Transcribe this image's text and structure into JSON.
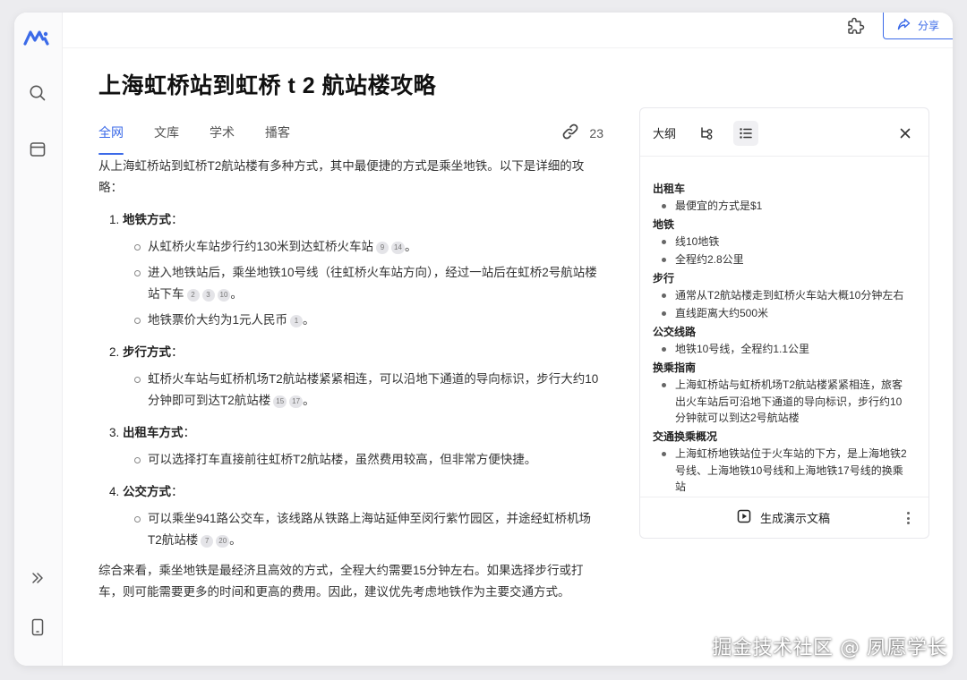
{
  "header": {
    "share_label": "分享"
  },
  "main": {
    "title": "上海虹桥站到虹桥 t 2 航站楼攻略",
    "tabs": [
      {
        "label": "全网"
      },
      {
        "label": "文库"
      },
      {
        "label": "学术"
      },
      {
        "label": "播客"
      }
    ],
    "reference_count": "23",
    "intro": "从上海虹桥站到虹桥T2航站楼有多种方式，其中最便捷的方式是乘坐地铁。以下是详细的攻略：",
    "sections": [
      {
        "number": "1.",
        "title": "地铁方式",
        "colon": "：",
        "bullets": [
          {
            "text": "从虹桥火车站步行约130米到达虹桥火车站",
            "cites": [
              "9",
              "14"
            ],
            "end": "。"
          },
          {
            "text": "进入地铁站后，乘坐地铁10号线（往虹桥火车站方向），经过一站后在虹桥2号航站楼站下车",
            "cites": [
              "2",
              "3",
              "10"
            ],
            "end": "。"
          },
          {
            "text": "地铁票价大约为1元人民币",
            "cites": [
              "1"
            ],
            "end": "。"
          }
        ]
      },
      {
        "number": "2.",
        "title": "步行方式",
        "colon": "：",
        "bullets": [
          {
            "text": "虹桥火车站与虹桥机场T2航站楼紧紧相连，可以沿地下通道的导向标识，步行大约10分钟即可到达T2航站楼",
            "cites": [
              "15",
              "17"
            ],
            "end": "。"
          }
        ]
      },
      {
        "number": "3.",
        "title": "出租车方式",
        "colon": "：",
        "bullets": [
          {
            "text": "可以选择打车直接前往虹桥T2航站楼，虽然费用较高，但非常方便快捷。",
            "cites": [],
            "end": ""
          }
        ]
      },
      {
        "number": "4.",
        "title": "公交方式",
        "colon": "：",
        "bullets": [
          {
            "text": "可以乘坐941路公交车，该线路从铁路上海站延伸至闵行紫竹园区，并途经虹桥机场T2航站楼",
            "cites": [
              "7",
              "20"
            ],
            "end": "。"
          }
        ]
      }
    ],
    "summary": "综合来看，乘坐地铁是最经济且高效的方式，全程大约需要15分钟左右。如果选择步行或打车，则可能需要更多的时间和更高的费用。因此，建议优先考虑地铁作为主要交通方式。"
  },
  "outline": {
    "title": "大纲",
    "groups": [
      {
        "heading": "出租车",
        "items": [
          "最便宜的方式是$1"
        ]
      },
      {
        "heading": "地铁",
        "items": [
          "线10地铁",
          "全程约2.8公里"
        ]
      },
      {
        "heading": "步行",
        "items": [
          "通常从T2航站楼走到虹桥火车站大概10分钟左右",
          "直线距离大约500米"
        ]
      },
      {
        "heading": "公交线路",
        "items": [
          "地铁10号线，全程约1.1公里"
        ]
      },
      {
        "heading": "换乘指南",
        "items": [
          "上海虹桥站与虹桥机场T2航站楼紧紧相连，旅客出火车站后可沿地下通道的导向标识，步行约10分钟就可以到达2号航站楼"
        ]
      },
      {
        "heading": "交通换乘概况",
        "items": [
          "上海虹桥地铁站位于火车站的下方，是上海地铁2号线、上海地铁10号线和上海地铁17号线的换乘站"
        ]
      }
    ],
    "generate_label": "生成演示文稿"
  },
  "watermark": "掘金技术社区 @ 夙愿学长",
  "colors": {
    "accent": "#3b6ae8",
    "text": "#333333",
    "citation_bg": "#e4e4e8"
  },
  "icons": {
    "logo": "app-logo",
    "rail": [
      "search-icon",
      "window-icon",
      "expand-icon",
      "phone-icon"
    ],
    "top": [
      "extension-icon",
      "share-icon"
    ],
    "panel": [
      "tree-icon",
      "list-icon",
      "close-icon",
      "slideshow-icon",
      "more-icon"
    ]
  }
}
